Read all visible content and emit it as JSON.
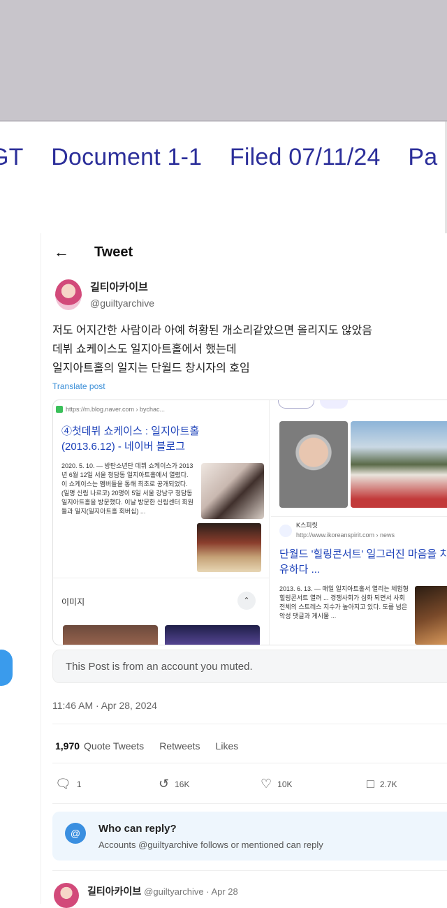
{
  "header": {
    "parts": [
      "GT",
      "Document 1-1",
      "Filed 07/11/24",
      "Pa"
    ]
  },
  "tweet": {
    "title": "Tweet",
    "author_name": "길티아카이브",
    "handle": "@guiltyarchive",
    "lines": [
      "저도 어지간한 사람이라 아예 허황된 개소리같았으면 올리지도 않았음",
      "데뷔 쇼케이스도 일지아트홀에서 했는데",
      "일지아트홀의 일지는 단월드 창시자의 호임"
    ],
    "translate": "Translate post",
    "embedded": {
      "left": {
        "source": "https://m.blog.naver.com › bychac...",
        "title": "④첫데뷔 쇼케이스 : 일지아트홀 (2013.6.12) - 네이버 블로그",
        "snippet": "2020. 5. 10. — 방탄소년단 데뷔 쇼케이스가 2013년 6월 12일 서울 청담동 일지아트홀에서 열렸다. 이 쇼케이스는 멤버들을 통해 최초로 공개되었다. (일명 신림 나르코) 20명이 5일 서울 강남구 청담동 일지아트홀을 방문했다. 이날 방문한 신림센터 회원들과 일지(일지아트홀 회버십) ...",
        "images_label": "이미지"
      },
      "right": {
        "site": "K스피릿",
        "url": "http://www.ikoreanspirit.com › news",
        "title": "단월드 '힐링콘서트' 일그러진 마음을 치유하다 ...",
        "snippet": "2013. 6. 13. — 매일 일지아트홀서 열리는 체험형 힐링콘서트 열려 ... 경쟁사회가 심화 되면서 사회 전체의 스트레스 지수가 높아지고 있다. 도를 넘은 악성 댓글과 게시물 ..."
      }
    },
    "muted_notice": "This Post is from an account you muted.",
    "timestamp": "11:46 AM · Apr 28, 2024",
    "stats": {
      "quote_count": "1,970",
      "quote_label": "Quote Tweets",
      "retweets_label": "Retweets",
      "likes_label": "Likes"
    },
    "actions": {
      "reply": "1",
      "retweet": "16K",
      "like": "10K",
      "bookmark": "2.7K"
    },
    "reply_box": {
      "title": "Who can reply?",
      "subtitle": "Accounts @guiltyarchive follows or mentioned can reply"
    },
    "next": {
      "name": "길티아카이브",
      "meta": "@guiltyarchive · Apr 28"
    }
  }
}
